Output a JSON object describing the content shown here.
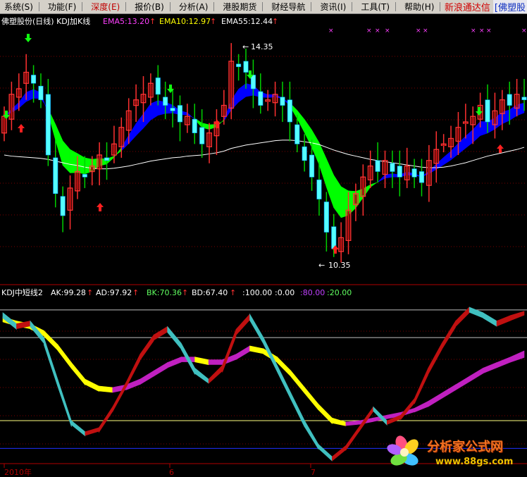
{
  "menu": {
    "items": [
      {
        "label": "系统(S)",
        "active": false
      },
      {
        "label": "功能(F)",
        "active": false
      },
      {
        "label": "深度(E)",
        "active": true
      },
      {
        "label": "报价(B)",
        "active": false
      },
      {
        "label": "分析(A)",
        "active": false
      },
      {
        "label": "港股期货",
        "active": false
      },
      {
        "label": "财经导航",
        "active": false
      },
      {
        "label": "资讯(I)",
        "active": false
      },
      {
        "label": "工具(T)",
        "active": false
      },
      {
        "label": "帮助(H)",
        "active": false
      }
    ],
    "brand_left": "新浪通达信",
    "brand_right": "[佛塑股"
  },
  "upper_legend": {
    "title": "佛塑股份(日线) KDJ加K线",
    "ema5": "EMA5:13.20",
    "ema10": "EMA10:12.97",
    "ema55": "EMA55:12.44"
  },
  "lower_legend": {
    "title": "KDJ中短线2",
    "ak": "AK:99.28",
    "ad": "AD:97.92",
    "bk": "BK:70.36",
    "bd": "BD:67.40",
    "l100": ":100.00",
    "l0": ":0.00",
    "l80": ":80.00",
    "l20": ":20.00"
  },
  "annotations": {
    "high": "14.35",
    "low": "10.35"
  },
  "xaxis": {
    "labels": [
      "2010年",
      "6",
      "7"
    ]
  },
  "watermark": {
    "title": "分析家公式网",
    "url": "www.88gs.com"
  },
  "colors": {
    "up": "#ff3030",
    "down": "#54ffff",
    "ema_fill_up": "#0000ff",
    "ema_fill_down": "#00ff00",
    "ema55": "#ffffff",
    "kdj_up": "#c01010",
    "kdj_down": "#40c0c0",
    "kdj_slow_up": "#c020c0",
    "kdj_slow_down": "#ffff00"
  },
  "chart_data": [
    {
      "type": "candlestick",
      "title": "佛塑股份(日线) KDJ加K线",
      "ylim": [
        10.0,
        14.6
      ],
      "annotated_high": 14.35,
      "annotated_low": 10.35,
      "series_ema5_last": 13.2,
      "series_ema10_last": 12.97,
      "series_ema55_last": 12.44,
      "close": [
        13.0,
        13.4,
        13.5,
        13.8,
        13.6,
        13.3,
        12.3,
        11.6,
        11.2,
        11.7,
        12.0,
        11.9,
        12.1,
        12.3,
        12.2,
        12.5,
        12.8,
        13.1,
        13.3,
        13.4,
        13.6,
        13.4,
        13.2,
        13.1,
        12.9,
        13.0,
        12.7,
        12.5,
        12.7,
        12.9,
        13.2,
        14.0,
        13.9,
        13.8,
        13.5,
        13.2,
        13.3,
        13.4,
        13.2,
        12.9,
        12.5,
        12.2,
        11.9,
        11.5,
        10.9,
        10.6,
        10.8,
        11.3,
        11.6,
        11.9,
        12.1,
        12.0,
        12.2,
        12.0,
        11.9,
        12.1,
        11.9,
        11.8,
        12.2,
        12.4,
        12.5,
        12.6,
        12.8,
        12.9,
        13.0,
        13.2,
        12.9,
        13.1,
        13.3,
        13.2,
        13.4,
        13.3
      ],
      "ema55": [
        12.3,
        12.28,
        12.27,
        12.26,
        12.25,
        12.24,
        12.22,
        12.19,
        12.16,
        12.13,
        12.11,
        12.08,
        12.06,
        12.05,
        12.05,
        12.06,
        12.08,
        12.1,
        12.13,
        12.16,
        12.19,
        12.21,
        12.23,
        12.25,
        12.26,
        12.28,
        12.29,
        12.3,
        12.32,
        12.34,
        12.37,
        12.42,
        12.45,
        12.48,
        12.5,
        12.52,
        12.54,
        12.56,
        12.57,
        12.57,
        12.56,
        12.54,
        12.52,
        12.49,
        12.44,
        12.39,
        12.35,
        12.31,
        12.28,
        12.25,
        12.22,
        12.2,
        12.18,
        12.16,
        12.14,
        12.12,
        12.1,
        12.08,
        12.07,
        12.07,
        12.08,
        12.1,
        12.13,
        12.16,
        12.2,
        12.24,
        12.28,
        12.31,
        12.34,
        12.37,
        12.4,
        12.44
      ]
    },
    {
      "type": "line",
      "title": "KDJ中短线2",
      "ylim": [
        -10,
        105
      ],
      "reference_lines": [
        100,
        80,
        20,
        0
      ],
      "series": [
        {
          "name": "AK",
          "last": 99.28,
          "values": [
            98,
            90,
            92,
            80,
            50,
            20,
            12,
            15,
            30,
            48,
            68,
            82,
            88,
            76,
            58,
            50,
            60,
            86,
            97,
            80,
            60,
            40,
            20,
            3,
            -6,
            2,
            16,
            30,
            20,
            24,
            36,
            58,
            76,
            92,
            102,
            98,
            92,
            96,
            99
          ]
        },
        {
          "name": "AD",
          "last": 97.92,
          "values": [
            96,
            88,
            90,
            78,
            48,
            19,
            11,
            14,
            29,
            47,
            66,
            80,
            86,
            74,
            56,
            49,
            58,
            84,
            95,
            78,
            58,
            38,
            18,
            2,
            -7,
            1,
            15,
            29,
            19,
            23,
            35,
            56,
            74,
            90,
            100,
            96,
            90,
            94,
            97.9
          ]
        },
        {
          "name": "BK",
          "last": 70.36,
          "values": [
            95,
            92,
            90,
            85,
            75,
            62,
            50,
            45,
            44,
            46,
            50,
            56,
            62,
            66,
            66,
            64,
            64,
            68,
            74,
            72,
            66,
            56,
            44,
            32,
            22,
            19,
            20,
            22,
            24,
            26,
            29,
            34,
            40,
            46,
            52,
            58,
            62,
            66,
            70.4
          ]
        },
        {
          "name": "BD",
          "last": 67.4,
          "values": [
            93,
            90,
            88,
            83,
            73,
            60,
            48,
            43,
            42,
            44,
            48,
            54,
            60,
            64,
            64,
            62,
            62,
            66,
            72,
            70,
            64,
            54,
            42,
            30,
            20,
            18,
            19,
            21,
            23,
            25,
            28,
            32,
            38,
            44,
            50,
            56,
            60,
            64,
            67.4
          ]
        }
      ]
    }
  ]
}
